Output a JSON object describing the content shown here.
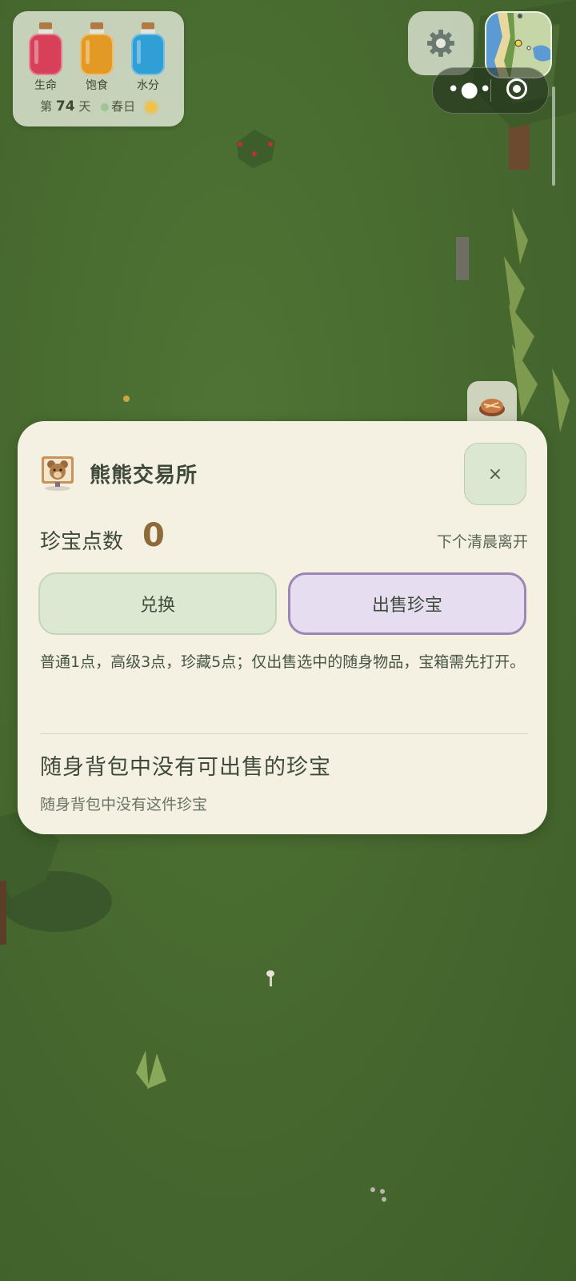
{
  "hud": {
    "stats": [
      {
        "label": "生命",
        "color": "#d8405a"
      },
      {
        "label": "饱食",
        "color": "#e39a24"
      },
      {
        "label": "水分",
        "color": "#2f9fd6"
      }
    ],
    "day_prefix": "第",
    "day_number": "74",
    "day_suffix": "天",
    "season": "春日"
  },
  "controls": {
    "settings_icon": "gear-icon",
    "minimap_icon": "minimap",
    "menu_icon": "more-dots-icon",
    "target_icon": "record-target-icon",
    "food_icon": "pie-icon"
  },
  "dialog": {
    "title": "熊熊交易所",
    "close_label": "×",
    "points_label": "珍宝点数",
    "points_value": "0",
    "leave_note": "下个清晨离开",
    "exchange_label": "兑换",
    "sell_label": "出售珍宝",
    "rules": "普通1点，高级3点，珍藏5点；仅出售选中的随身物品，宝箱需先打开。",
    "empty_title": "随身背包中没有可出售的珍宝",
    "empty_subtitle": "随身背包中没有这件珍宝"
  },
  "colors": {
    "accent_purple": "#9b86b4",
    "accent_green": "#dce7d2",
    "panel_bg": "#f5f1e2"
  }
}
